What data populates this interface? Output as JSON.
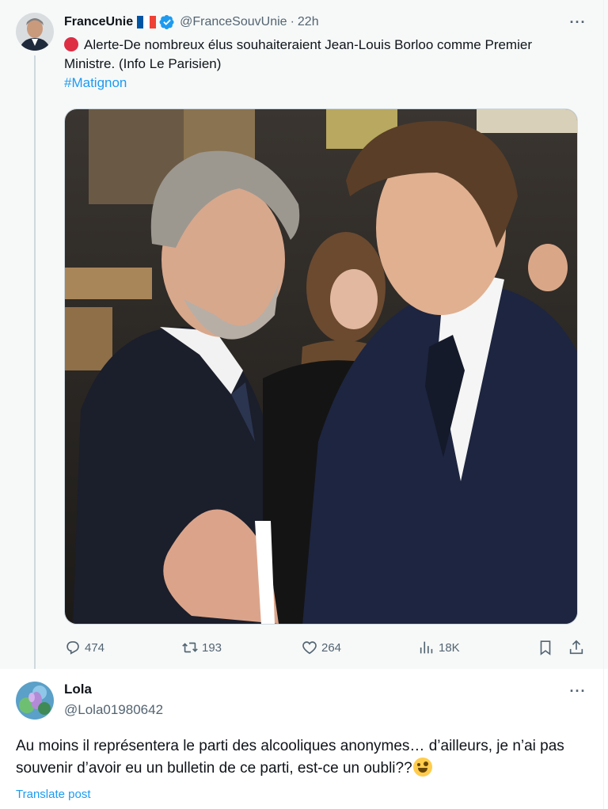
{
  "tweet": {
    "author_name": "FranceUnie",
    "handle": "@FranceSouvUnie",
    "separator": "·",
    "time": "22h",
    "text_line": "Alerte-De nombreux élus souhaiteraient Jean-Louis Borloo comme Premier Ministre. (Info Le Parisien)",
    "hashtag": "#Matignon",
    "more_label": "···",
    "stats": {
      "replies": "474",
      "retweets": "193",
      "likes": "264",
      "views": "18K"
    }
  },
  "reply": {
    "author_name": "Lola",
    "handle": "@Lola01980642",
    "text": "Au moins il représentera le parti des alcooliques anonymes… d’ailleurs, je n’ai pas souvenir d’avoir eu un bulletin de ce parti, est-ce un oubli??",
    "translate_label": "Translate post",
    "more_label": "···"
  },
  "colors": {
    "accent": "#1d9bf0",
    "secondary_text": "#536471",
    "primary_text": "#0f1419",
    "thread_background": "#f7f9f9"
  },
  "icons": {
    "reply": "reply-bubble-icon",
    "retweet": "retweet-icon",
    "like": "heart-icon",
    "views": "analytics-bars-icon",
    "bookmark": "bookmark-icon",
    "share": "share-upload-icon",
    "verified": "verified-badge-icon",
    "flag": "france-flag-icon",
    "alert": "red-circle-icon",
    "emoji": "zany-face-icon"
  }
}
